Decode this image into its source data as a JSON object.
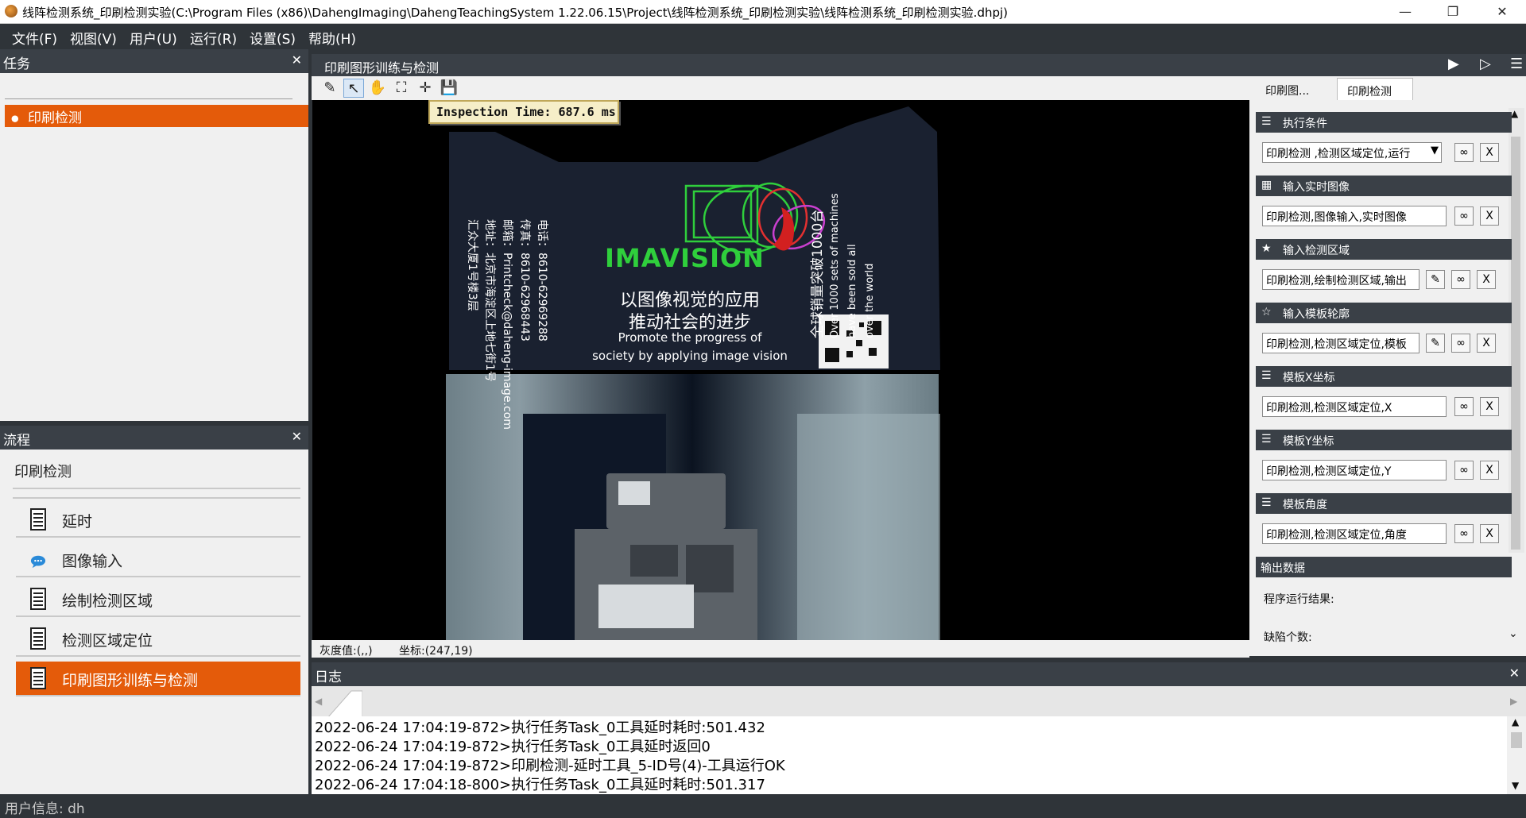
{
  "window": {
    "title": "线阵检测系统_印刷检测实验(C:\\Program Files (x86)\\DahengImaging\\DahengTeachingSystem 1.22.06.15\\Project\\线阵检测系统_印刷检测实验\\线阵检测系统_印刷检测实验.dhpj)",
    "minimize": "—",
    "restore": "❐",
    "close": "✕"
  },
  "menu": [
    "文件(F)",
    "视图(V)",
    "用户(U)",
    "运行(R)",
    "设置(S)",
    "帮助(H)"
  ],
  "task_panel": {
    "title": "任务",
    "close": "✕",
    "items": [
      "印刷检测"
    ],
    "bullet": "●"
  },
  "flow_panel": {
    "title": "流程",
    "close": "✕",
    "flow_name": "印刷检测",
    "items": [
      {
        "label": "延时",
        "icon": "list-doc-icon"
      },
      {
        "label": "图像输入",
        "icon": "speech-bubble-icon"
      },
      {
        "label": "绘制检测区域",
        "icon": "list-doc-icon"
      },
      {
        "label": "检测区域定位",
        "icon": "list-doc-icon"
      },
      {
        "label": "印刷图形训练与检测",
        "icon": "list-doc-icon",
        "active": true
      }
    ]
  },
  "center": {
    "title": "印刷图形训练与检测",
    "run_icons": [
      "▶",
      "▷",
      "☰"
    ],
    "toolbar": [
      "✎",
      "↖",
      "✋",
      "⛶",
      "✛",
      "💾"
    ],
    "image": {
      "inspection_time": "Inspection  Time:  687.6  ms",
      "box_left_lines": [
        "电话：8610-62969288",
        "传真：8610-62968443",
        "邮箱：Printcheck@daheng-image.com",
        "地址：北京市海淀区上地七街1号",
        "汇众大厦1号楼3层"
      ],
      "brand": "IMAVISION",
      "slogan_cn_1": "以图像视觉的应用",
      "slogan_cn_2": "推动社会的进步",
      "slogan_en_1": "Promote the progress of",
      "slogan_en_2": "society by applying image vision",
      "right_cn": "全球销量突破1000台",
      "right_en_1": "Over 1000 sets of machines",
      "right_en_2": "have been sold all",
      "right_en_3": "over the world"
    },
    "status_gray": "灰度值:(,,)",
    "status_coord": "坐标:(247,19)"
  },
  "properties": {
    "tabs": [
      "印刷图...",
      "印刷检测"
    ],
    "sections": [
      {
        "icon": "☰",
        "title": "执行条件",
        "value": "印刷检测 ,检测区域定位,运行",
        "dropdown": true,
        "pencil": false
      },
      {
        "icon": "▦",
        "title": "输入实时图像",
        "value": "印刷检测,图像输入,实时图像",
        "dropdown": false,
        "pencil": false
      },
      {
        "icon": "★",
        "title": "输入检测区域",
        "value": "印刷检测,绘制检测区域,输出",
        "dropdown": false,
        "pencil": true
      },
      {
        "icon": "☆",
        "title": "输入模板轮廓",
        "value": "印刷检测,检测区域定位,模板",
        "dropdown": false,
        "pencil": true
      },
      {
        "icon": "☰",
        "title": "模板X坐标",
        "value": "印刷检测,检测区域定位,X",
        "dropdown": false,
        "pencil": false
      },
      {
        "icon": "☰",
        "title": "模板Y坐标",
        "value": "印刷检测,检测区域定位,Y",
        "dropdown": false,
        "pencil": false
      },
      {
        "icon": "☰",
        "title": "模板角度",
        "value": "印刷检测,检测区域定位,角度",
        "dropdown": false,
        "pencil": false
      }
    ],
    "link_btn": "∞",
    "clear_btn": "X",
    "pencil_btn": "✎",
    "output_title": "输出数据",
    "output_labels": [
      "程序运行结果:",
      "缺陷个数:"
    ]
  },
  "log": {
    "title": "日志",
    "close": "✕",
    "lines": [
      "2022-06-24 17:04:19-872>执行任务Task_0工具延时耗时:501.432",
      "2022-06-24 17:04:19-872>执行任务Task_0工具延时返回0",
      "2022-06-24 17:04:19-872>印刷检测-延时工具_5-ID号(4)-工具运行OK",
      "2022-06-24 17:04:18-800>执行任务Task_0工具延时耗时:501.317"
    ]
  },
  "footer": {
    "user_info": "用户信息: dh"
  },
  "colors": {
    "accent": "#e45b0a",
    "dark": "#2f3439",
    "panel_header": "#3a4047"
  }
}
